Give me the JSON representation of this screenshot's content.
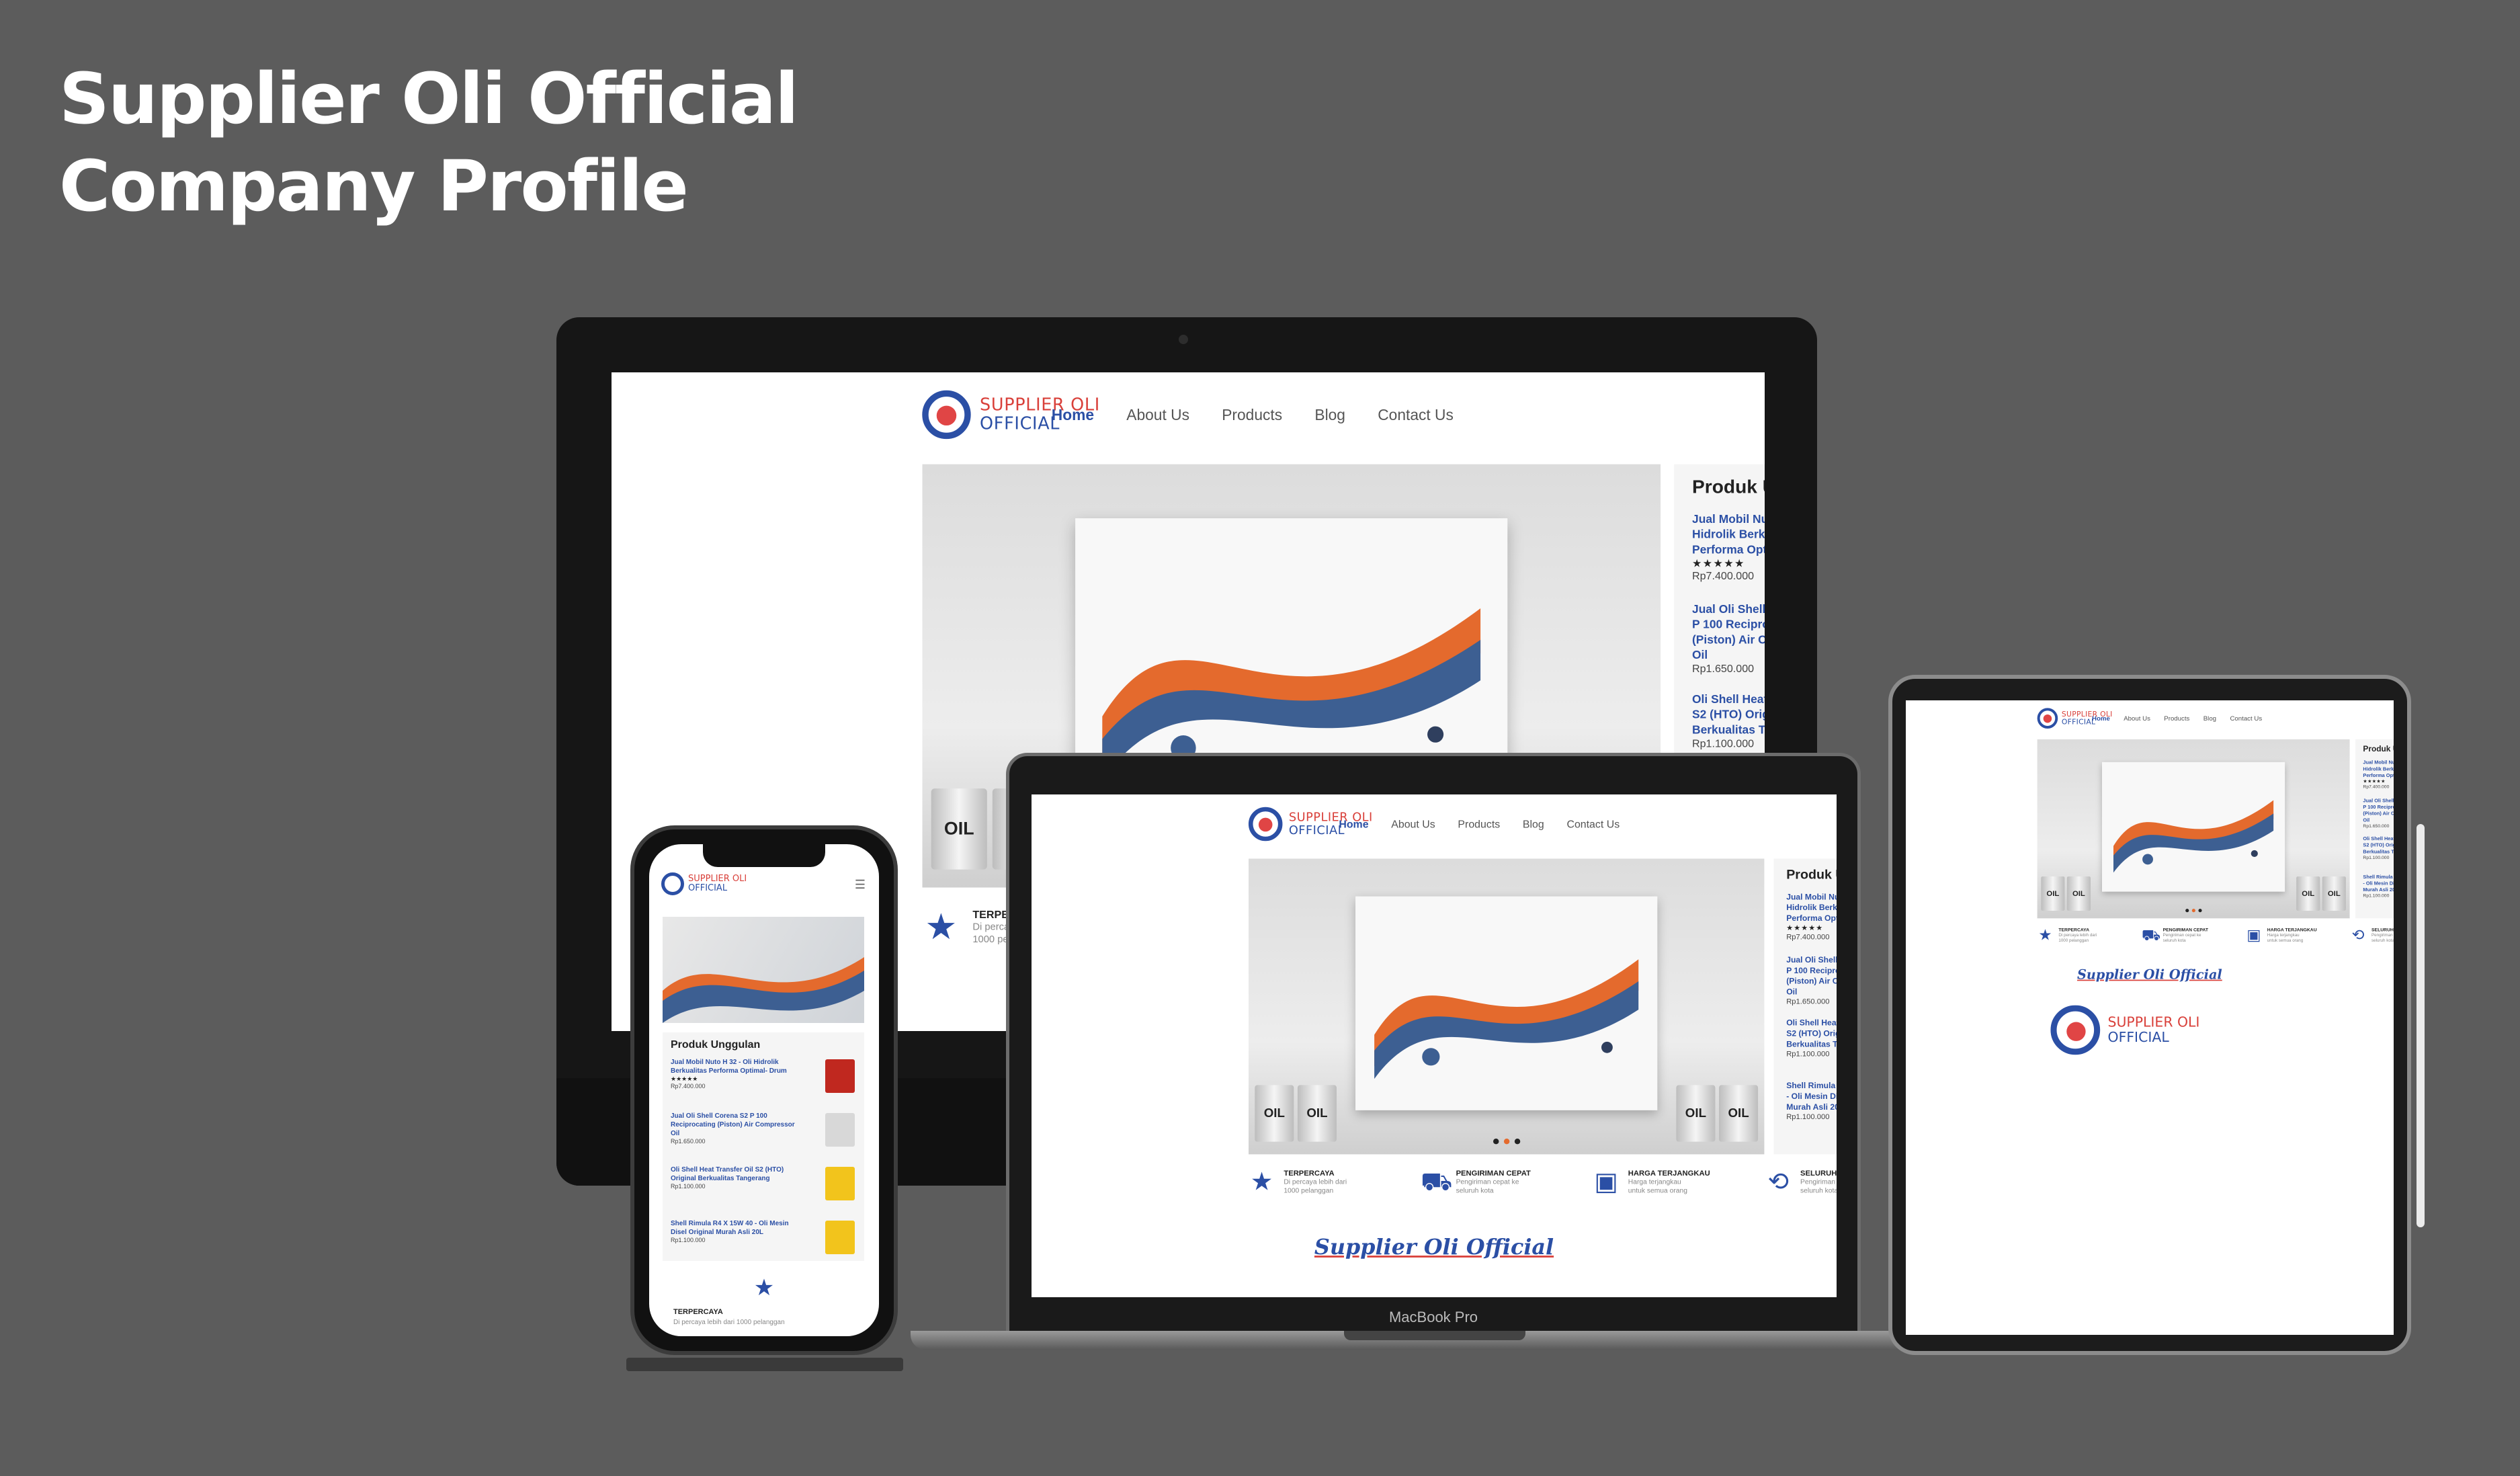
{
  "headline": {
    "line1": "Supplier Oli Official",
    "line2": "Company Profile"
  },
  "site": {
    "logo": {
      "line1": "SUPPLIER OLI",
      "line2": "OFFICIAL"
    },
    "nav": [
      "Home",
      "About Us",
      "Products",
      "Blog",
      "Contact Us"
    ],
    "sidebar_title": "Produk Unggulan",
    "products": [
      {
        "name": "Jual Mobil Nuto H 32 - Oli Hidrolik Berkualitas Performa Optimal- Drum",
        "price": "Rp7.400.000",
        "rating": "★★★★★"
      },
      {
        "name": "Jual Oli Shell Corena S2 P 100 Reciprocating (Piston) Air Compressor Oil",
        "price": "Rp1.650.000"
      },
      {
        "name": "Oli Shell Heat Transfer Oil S2 (HTO) Original Berkualitas Tangerang",
        "price": "Rp1.100.000"
      },
      {
        "name": "Shell Rimula R4 X 15W 40 - Oli Mesin Disel Original Murah Asli 20L",
        "price": "Rp1.100.000"
      }
    ],
    "features": [
      {
        "title": "TERPERCAYA",
        "desc": "Di percaya lebih dari 1000 pelanggan",
        "icon": "star-icon"
      },
      {
        "title": "PENGIRIMAN CEPAT",
        "desc": "Pengiriman cepat ke seluruh kota",
        "icon": "truck-icon"
      },
      {
        "title": "HARGA TERJANGKAU",
        "desc": "Harga terjangkau untuk semua orang",
        "icon": "wallet-icon"
      },
      {
        "title": "SELURUH KOTA",
        "desc": "Pengiriman tersedia di seluruh kota",
        "icon": "route-icon"
      }
    ],
    "brand_script": "Supplier Oli Official",
    "barrel_label": "OIL",
    "menu_icon": "hamburger-icon"
  },
  "laptop_label": "MacBook Pro",
  "colors": {
    "primary": "#2b4fa5",
    "accent": "#d9403a",
    "background": "#5c5c5c"
  }
}
